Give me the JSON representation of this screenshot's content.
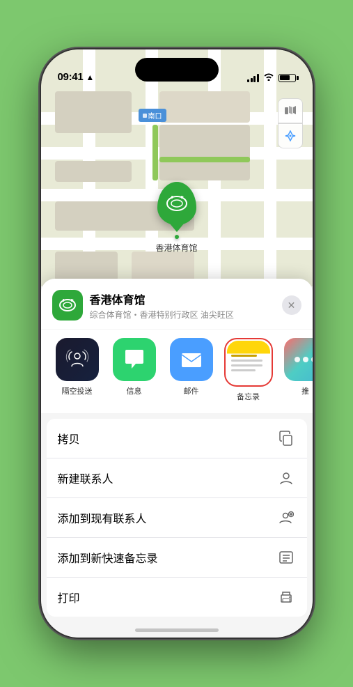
{
  "statusBar": {
    "time": "09:41",
    "locationArrow": "▲"
  },
  "mapLabel": "南口",
  "markerName": "香港体育馆",
  "mapButtons": {
    "mapType": "🗺",
    "location": "⬆"
  },
  "locationCard": {
    "name": "香港体育馆",
    "subtitle": "综合体育馆・香港特别行政区 油尖旺区",
    "closeLabel": "✕"
  },
  "shareApps": [
    {
      "id": "airdrop",
      "label": "隔空投送",
      "icon": "📡"
    },
    {
      "id": "messages",
      "label": "信息",
      "icon": "💬"
    },
    {
      "id": "mail",
      "label": "邮件",
      "icon": "✉️"
    },
    {
      "id": "notes",
      "label": "备忘录",
      "icon": ""
    },
    {
      "id": "more",
      "label": "推",
      "icon": "•••"
    }
  ],
  "actions": [
    {
      "id": "copy",
      "label": "拷贝",
      "icon": "⧉"
    },
    {
      "id": "new-contact",
      "label": "新建联系人",
      "icon": "👤"
    },
    {
      "id": "add-contact",
      "label": "添加到现有联系人",
      "icon": "👤+"
    },
    {
      "id": "quick-note",
      "label": "添加到新快速备忘录",
      "icon": "⬛"
    },
    {
      "id": "print",
      "label": "打印",
      "icon": "🖨"
    }
  ]
}
